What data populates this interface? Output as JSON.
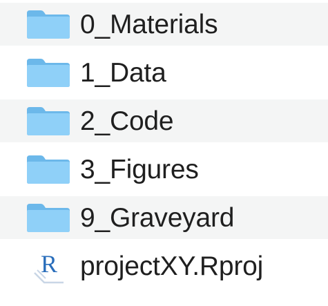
{
  "files": [
    {
      "name": "0_Materials",
      "icon": "folder-icon"
    },
    {
      "name": "1_Data",
      "icon": "folder-icon"
    },
    {
      "name": "2_Code",
      "icon": "folder-icon"
    },
    {
      "name": "3_Figures",
      "icon": "folder-icon"
    },
    {
      "name": "9_Graveyard",
      "icon": "folder-icon"
    },
    {
      "name": "projectXY.Rproj",
      "icon": "rproj-icon",
      "icon_letter": "R"
    }
  ],
  "colors": {
    "folder_back": "#6cb8ea",
    "folder_front": "#8fd0f8",
    "stripe": "#f4f5f5",
    "text": "#1f1f1f",
    "r_blue": "#2a6ebb"
  }
}
